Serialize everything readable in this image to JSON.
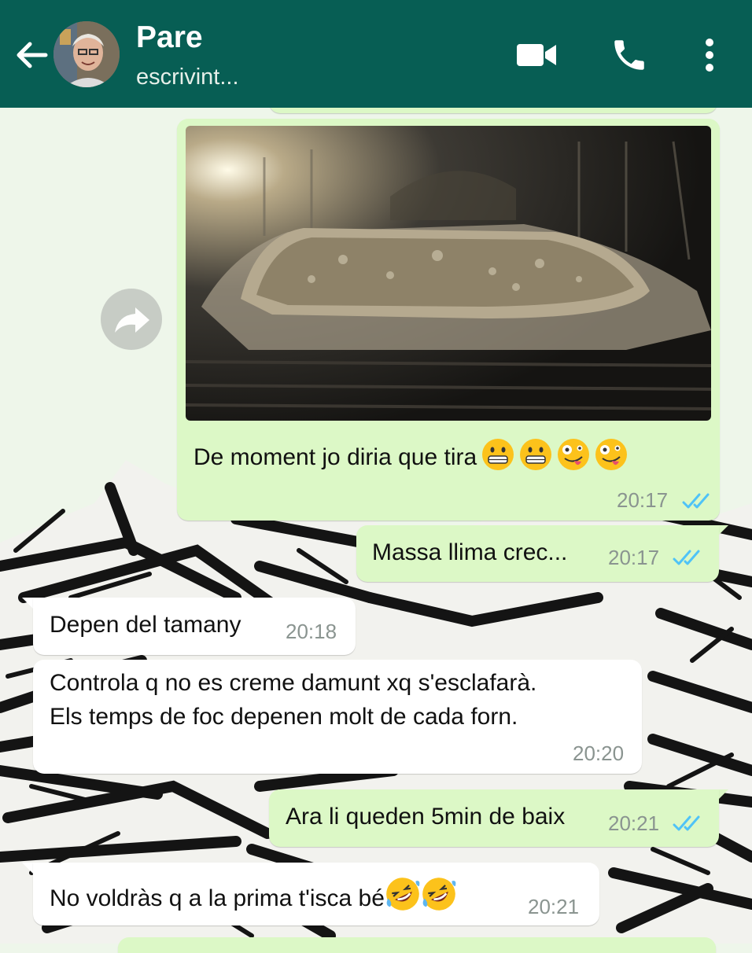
{
  "header": {
    "contact_name": "Pare",
    "status": "escrivint..."
  },
  "messages": [
    {
      "direction": "out",
      "type": "photo",
      "caption": "De moment jo diria que tira",
      "emoji": [
        "grimacing-face",
        "grimacing-face",
        "zany-face",
        "zany-face"
      ],
      "time": "20:17",
      "status": "read"
    },
    {
      "direction": "out",
      "text": "Massa llima crec...",
      "time": "20:17",
      "status": "read"
    },
    {
      "direction": "in",
      "text": "Depen del tamany",
      "time": "20:18"
    },
    {
      "direction": "in",
      "lines": [
        "Controla q no es creme damunt xq s'esclafarà.",
        "Els temps de foc depenen molt de cada forn."
      ],
      "time": "20:20"
    },
    {
      "direction": "out",
      "text": "Ara li queden 5min de baix",
      "time": "20:21",
      "status": "read"
    },
    {
      "direction": "in",
      "text": "No voldràs q a la prima t'isca bé",
      "emoji": [
        "rolling-on-floor-laughing",
        "rolling-on-floor-laughing"
      ],
      "time": "20:21"
    }
  ],
  "colors": {
    "header": "#075e54",
    "outgoing_bubble": "#dcf8c6",
    "incoming_bubble": "#ffffff",
    "read_ticks": "#4fc3f7",
    "wallpaper": "#eef6ea"
  }
}
